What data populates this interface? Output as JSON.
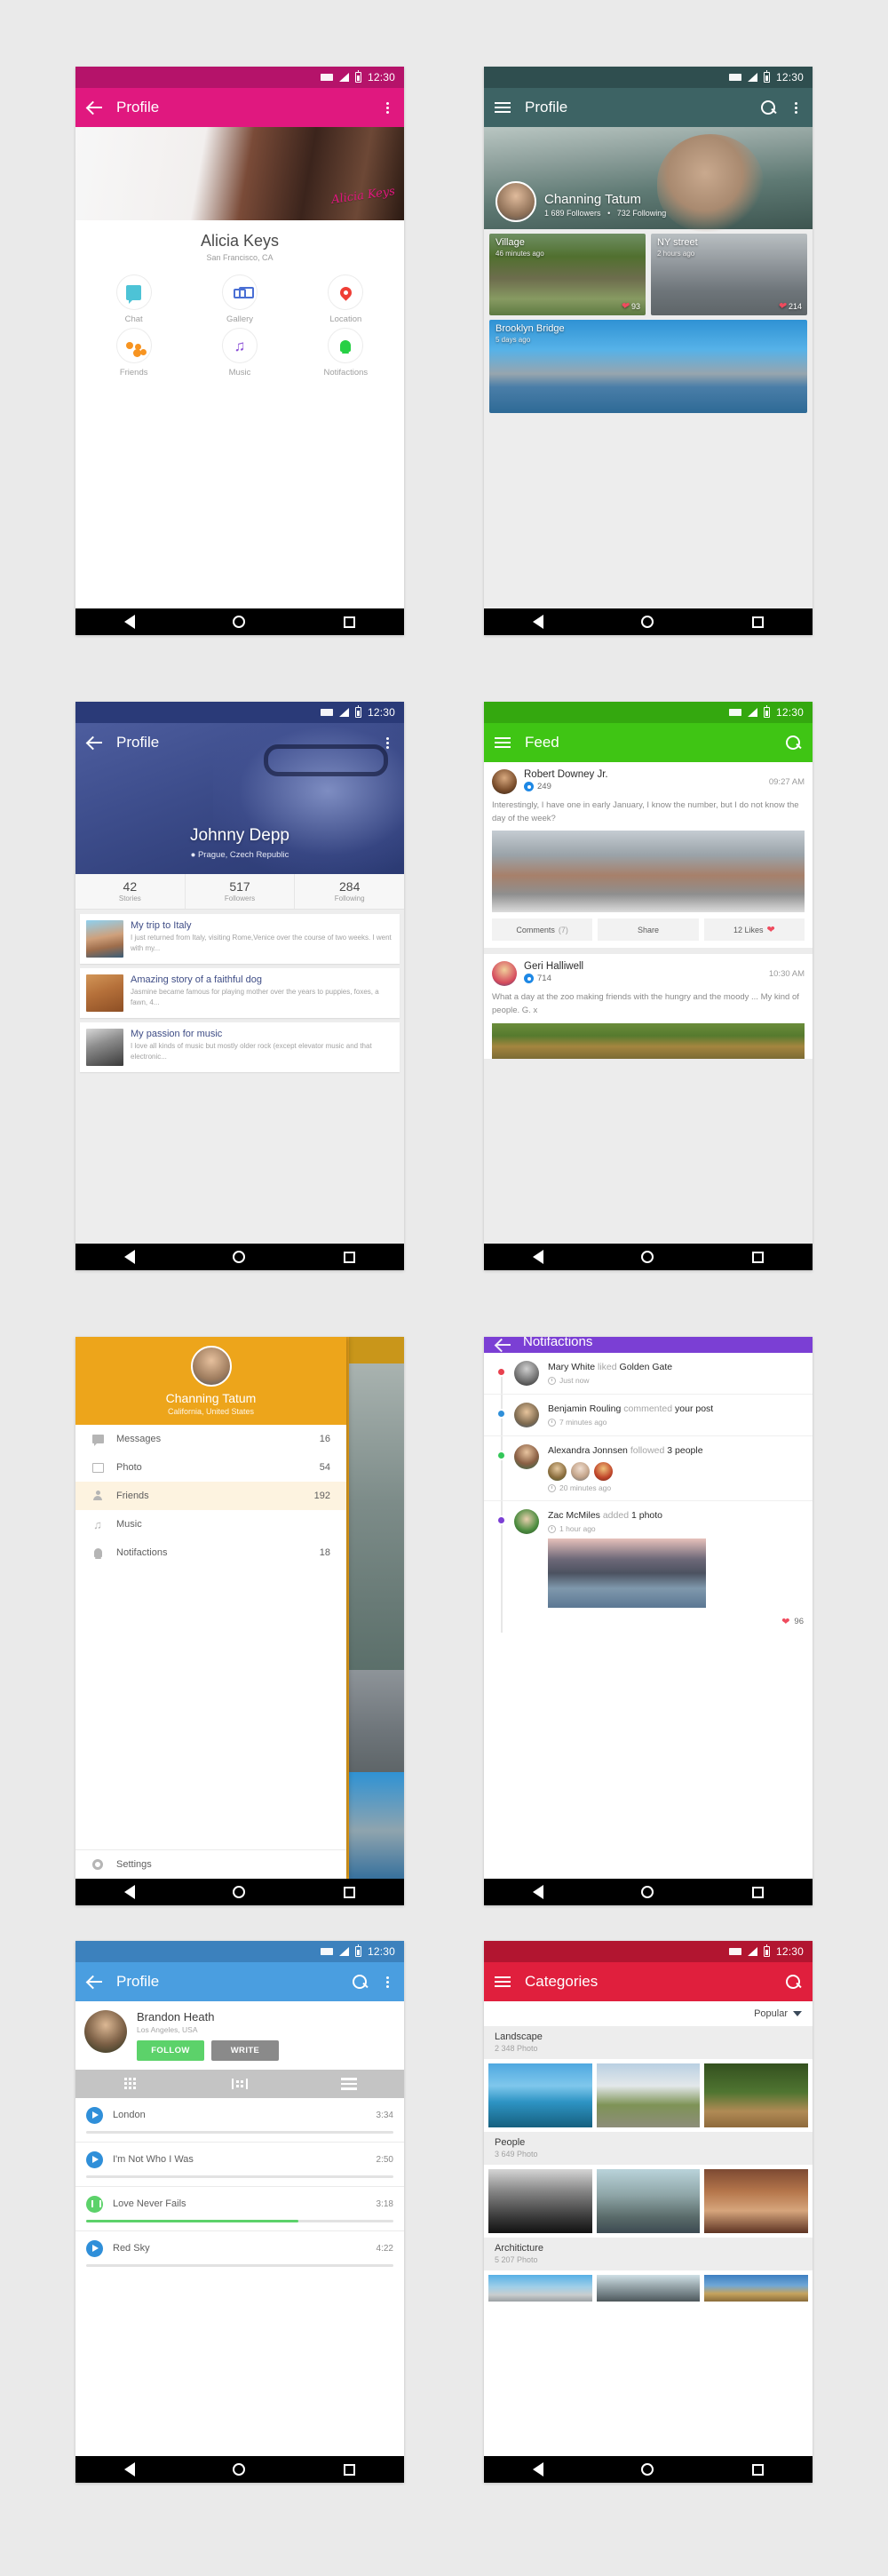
{
  "status": {
    "time": "12:30"
  },
  "phone1": {
    "appbar": {
      "title": "Profile"
    },
    "name": "Alicia Keys",
    "location": "San Francisco, CA",
    "signature": "Alicia Keys",
    "actions": [
      {
        "label": "Chat",
        "icon": "chat-icon"
      },
      {
        "label": "Gallery",
        "icon": "gallery-icon"
      },
      {
        "label": "Location",
        "icon": "location-pin-icon"
      },
      {
        "label": "Friends",
        "icon": "friends-icon"
      },
      {
        "label": "Music",
        "icon": "music-note-icon"
      },
      {
        "label": "Notifactions",
        "icon": "bell-icon"
      }
    ]
  },
  "phone2": {
    "appbar": {
      "title": "Profile"
    },
    "name": "Channing Tatum",
    "followers": "1 689 Followers",
    "separator": "•",
    "following": "732 Following",
    "tiles": [
      {
        "title": "Village",
        "time": "46 minutes ago",
        "likes": "93"
      },
      {
        "title": "NY street",
        "time": "2 hours ago",
        "likes": "214"
      },
      {
        "title": "Brooklyn Bridge",
        "time": "5 days ago",
        "likes": ""
      }
    ]
  },
  "phone3": {
    "appbar": {
      "title": "Profile"
    },
    "name": "Johnny Depp",
    "location": "Prague, Czech Republic",
    "stats": [
      {
        "value": "42",
        "label": "Stories"
      },
      {
        "value": "517",
        "label": "Followers"
      },
      {
        "value": "284",
        "label": "Following"
      }
    ],
    "stories": [
      {
        "title": "My trip to Italy",
        "excerpt": "I just returned from Italy, visiting Rome,Venice over the course of two weeks. I went with my..."
      },
      {
        "title": "Amazing story of a faithful dog",
        "excerpt": "Jasmine became famous for playing mother over the years to puppies, foxes, a fawn, 4..."
      },
      {
        "title": "My passion for music",
        "excerpt": "I love all kinds of music but mostly older rock (except elevator music and that electronic..."
      }
    ]
  },
  "phone4": {
    "appbar": {
      "title": "Feed"
    },
    "posts": [
      {
        "author": "Robert Downey Jr.",
        "views": "249",
        "time": "09:27 AM",
        "text": "Interestingly, I have one in early January, I know the number, but I do not know the day of the week?",
        "actions": {
          "comments_label": "Comments",
          "comments_count": "(7)",
          "share_label": "Share",
          "likes_label": "12 Likes"
        }
      },
      {
        "author": "Geri Halliwell",
        "views": "714",
        "time": "10:30 AM",
        "text": "What a day at the zoo making friends with the hungry and the moody ... My kind of people. G. x"
      }
    ]
  },
  "phone5": {
    "name": "Channing Tatum",
    "location": "California, United States",
    "items": [
      {
        "label": "Messages",
        "count": "16",
        "icon": "message-icon"
      },
      {
        "label": "Photo",
        "count": "54",
        "icon": "photo-icon"
      },
      {
        "label": "Friends",
        "count": "192",
        "icon": "person-icon"
      },
      {
        "label": "Music",
        "count": "",
        "icon": "music-note-icon"
      },
      {
        "label": "Notifactions",
        "count": "18",
        "icon": "bell-icon"
      }
    ],
    "settings": {
      "label": "Settings",
      "icon": "gear-icon"
    }
  },
  "phone6": {
    "appbar": {
      "title": "Notifactions"
    },
    "items": [
      {
        "actor": "Mary White",
        "verb": "liked",
        "object": "Golden Gate",
        "time": "Just now",
        "dot_color": "#e8414e"
      },
      {
        "actor": "Benjamin Rouling",
        "verb": "commented",
        "object": "your post",
        "time": "7 minutes ago",
        "dot_color": "#2f8fd9"
      },
      {
        "actor": "Alexandra Jonnsen",
        "verb": "followed",
        "object": "3 people",
        "time": "20 minutes ago",
        "dot_color": "#34c759"
      },
      {
        "actor": "Zac McMiles",
        "verb": "added",
        "object": "1 photo",
        "time": "1 hour ago",
        "dot_color": "#7b3fd4",
        "likes": "96"
      }
    ]
  },
  "phone7": {
    "appbar": {
      "title": "Profile"
    },
    "name": "Brandon Heath",
    "location": "Los Angeles, USA",
    "follow_label": "FOLLOW",
    "write_label": "WRITE",
    "tracks": [
      {
        "title": "London",
        "duration": "3:34",
        "progress": 0,
        "state": "play"
      },
      {
        "title": "I'm Not Who I Was",
        "duration": "2:50",
        "progress": 0,
        "state": "play"
      },
      {
        "title": "Love Never Fails",
        "duration": "3:18",
        "progress": 69,
        "state": "pause"
      },
      {
        "title": "Red Sky",
        "duration": "4:22",
        "progress": 0,
        "state": "play"
      }
    ]
  },
  "phone8": {
    "appbar": {
      "title": "Categories"
    },
    "sort_label": "Popular",
    "sections": [
      {
        "title": "Landscape",
        "count": "2 348 Photo"
      },
      {
        "title": "People",
        "count": "3 649 Photo"
      },
      {
        "title": "Architicture",
        "count": "5 207 Photo"
      }
    ]
  },
  "colors": {
    "pink": "#e0187f",
    "teal": "#3d6364",
    "blue_dark": "#36468c",
    "green": "#3fc514",
    "amber": "#eda51b",
    "purple": "#7b3fd4",
    "blue": "#4a9ee0",
    "red": "#e01f3d"
  }
}
